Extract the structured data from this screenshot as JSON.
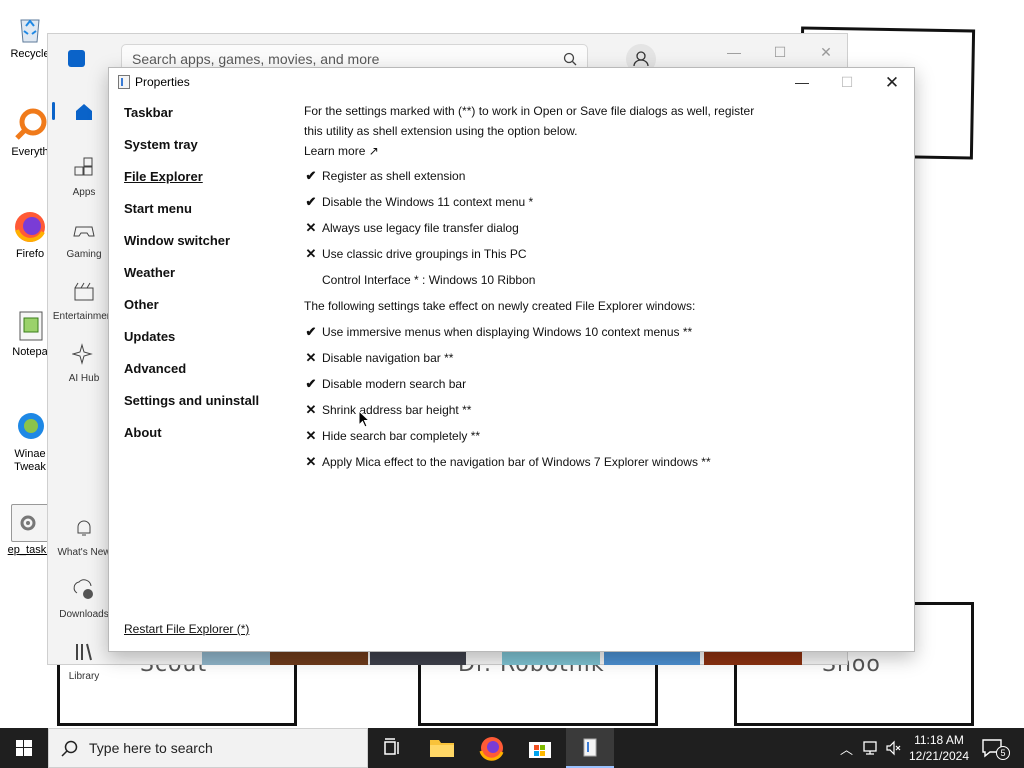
{
  "desktop": {
    "icons": [
      {
        "label": "Recycle",
        "name": "recycle-bin"
      },
      {
        "label": "Everyth",
        "name": "everything"
      },
      {
        "label": "Firefo",
        "name": "firefox"
      },
      {
        "label": "Notepa",
        "name": "notepad"
      },
      {
        "label": "Winae\nTweak",
        "name": "winaero-tweaker"
      },
      {
        "label": "ep_taskb",
        "name": "ep-taskbar"
      }
    ],
    "wallpaper_labels": [
      "Scout",
      "Dr. Robotnik",
      "Shoo"
    ]
  },
  "store": {
    "search_placeholder": "Search apps, games, movies, and more",
    "nav": [
      {
        "label": "Home"
      },
      {
        "label": "Apps"
      },
      {
        "label": "Gaming"
      },
      {
        "label": "Entertainment"
      },
      {
        "label": "AI Hub"
      },
      {
        "label": "What's New"
      },
      {
        "label": "Downloads"
      },
      {
        "label": "Library"
      }
    ]
  },
  "dialog": {
    "title": "Properties",
    "sidebar": [
      {
        "label": "Taskbar",
        "active": false
      },
      {
        "label": "System tray",
        "active": false
      },
      {
        "label": "File Explorer",
        "active": true
      },
      {
        "label": "Start menu",
        "active": false
      },
      {
        "label": "Window switcher",
        "active": false
      },
      {
        "label": "Weather",
        "active": false
      },
      {
        "label": "Other",
        "active": false
      },
      {
        "label": "Updates",
        "active": false
      },
      {
        "label": "Advanced",
        "active": false
      },
      {
        "label": "Settings and uninstall",
        "active": false
      },
      {
        "label": "About",
        "active": false
      }
    ],
    "restart_link": "Restart File Explorer (*)",
    "intro": "For the settings marked with (**) to work in Open or Save file dialogs as well, register this utility as shell extension using the option below.",
    "learn_more": "Learn more ↗",
    "options_a": [
      {
        "label": "Register as shell extension",
        "checked": true
      },
      {
        "label": "Disable the Windows 11 context menu *",
        "checked": true
      },
      {
        "label": "Always use legacy file transfer dialog",
        "checked": false
      },
      {
        "label": "Use classic drive groupings in This PC",
        "checked": false
      }
    ],
    "control_interface": "Control Interface * : Windows 10 Ribbon",
    "section_b": "The following settings take effect on newly created File Explorer windows:",
    "options_b": [
      {
        "label": "Use immersive menus when displaying Windows 10 context menus **",
        "checked": true
      },
      {
        "label": "Disable navigation bar **",
        "checked": false
      },
      {
        "label": "Disable modern search bar",
        "checked": true
      },
      {
        "label": "Shrink address bar height **",
        "checked": false
      },
      {
        "label": "Hide search bar completely **",
        "checked": false
      },
      {
        "label": "Apply Mica effect to the navigation bar of Windows 7 Explorer windows **",
        "checked": false
      }
    ]
  },
  "taskbar": {
    "search_text": "Type here to search",
    "time": "11:18 AM",
    "date": "12/21/2024",
    "notification_count": "5"
  }
}
